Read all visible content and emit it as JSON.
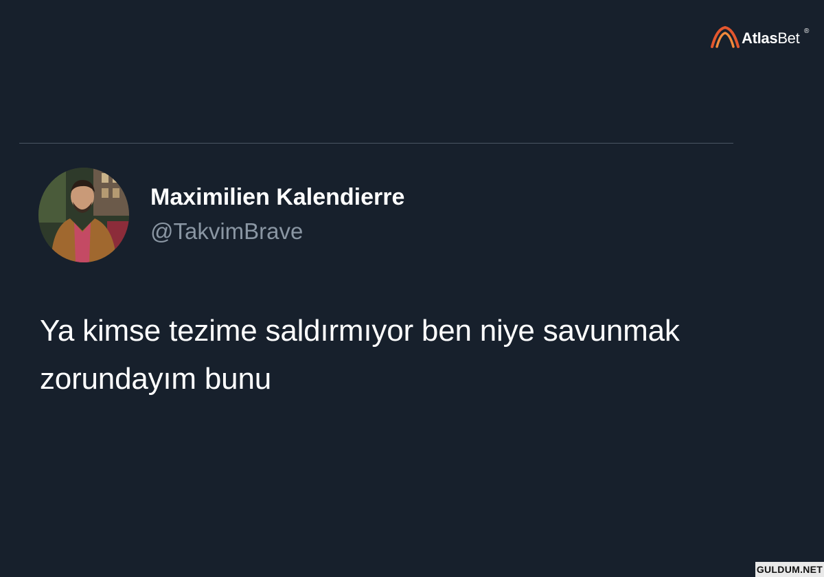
{
  "brand": {
    "name_bold": "Atlas",
    "name_light": "Bet",
    "registered_mark": "®",
    "accent_color": "#e4572e"
  },
  "tweet": {
    "author_name": "Maximilien Kalendierre",
    "author_handle": "@TakvimBrave",
    "text": "Ya kimse tezime saldırmıyor ben niye savunmak zorundayım bunu"
  },
  "watermark": {
    "text": "GULDUM.NET"
  },
  "theme": {
    "background": "#17202c",
    "text_primary": "#ffffff",
    "text_secondary": "#8a96a3",
    "divider": "#4b5563"
  }
}
